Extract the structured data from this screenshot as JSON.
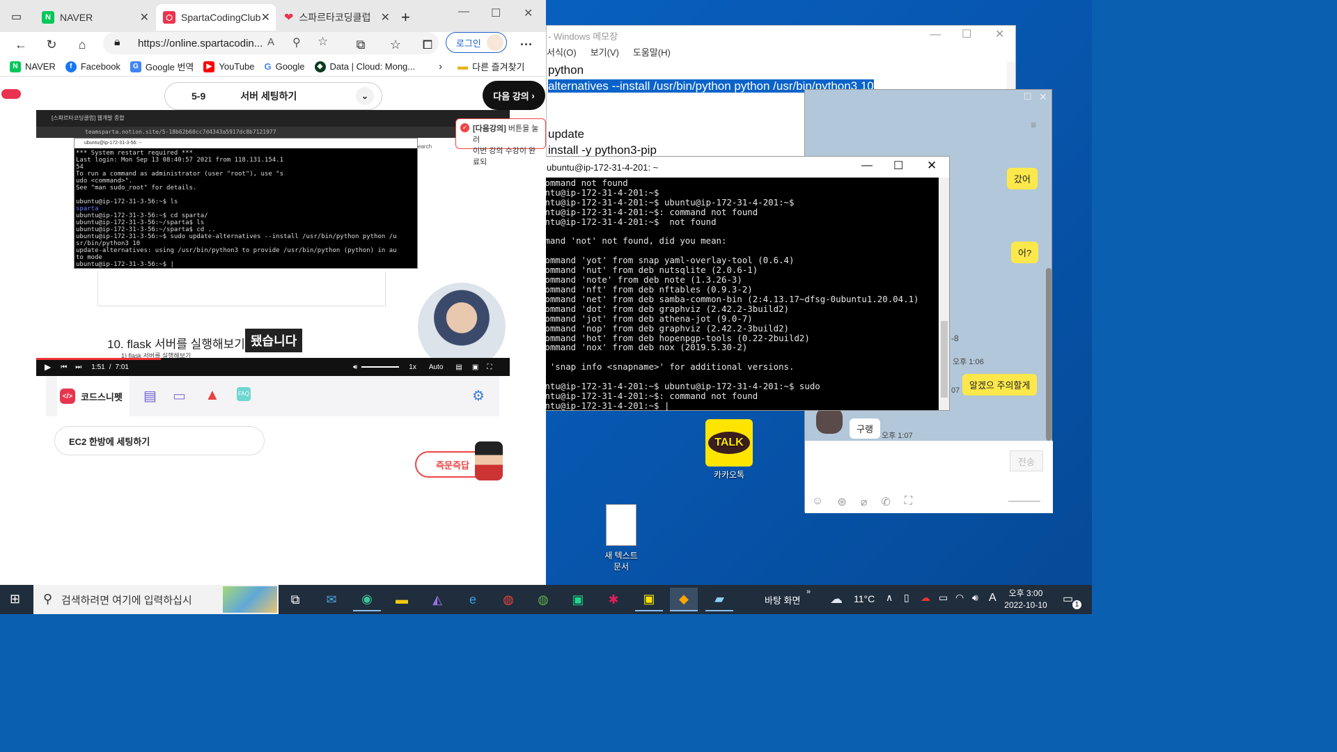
{
  "browser": {
    "tabs": [
      {
        "label": "NAVER",
        "icon": "naver-icon"
      },
      {
        "label": "SpartaCodingClub",
        "icon": "sparta-icon"
      },
      {
        "label": "스파르타코딩클럽",
        "icon": "heart-icon"
      }
    ],
    "url": "https://online.spartacodin...",
    "login_label": "로그인",
    "bookmarks": [
      "NAVER",
      "Facebook",
      "Google 번역",
      "YouTube",
      "Google",
      "Data | Cloud: Mong..."
    ],
    "other_bookmarks": "다른 즐겨찾기"
  },
  "lesson": {
    "number": "5-9",
    "title": "서버 세팅하기",
    "next_label": "다음 강의",
    "tooltip_bold": "[다음강의]",
    "tooltip_line1": " 버튼을 눌러",
    "tooltip_line2": "이번 강의 수강이 완료되"
  },
  "video": {
    "address": "teamsparta.notion.site/5-18b62b60cc7d4343a5917dc8b7121977",
    "tab_label": "[스파르타코딩클럽] 웹개발 종합",
    "inner_term_title": "ubuntu@ip-172-31-3-56: ~",
    "inner_term_lines": [
      "*** System restart required ***",
      "Last login: Mon Sep 13 08:40:57 2021 from 118.131.154.1",
      "54",
      "To run a command as administrator (user \"root\"), use \"s",
      "udo <command>\".",
      "See \"man sudo_root\" for details.",
      "",
      "ubuntu@ip-172-31-3-56:~$ ls",
      "sparta",
      "ubuntu@ip-172-31-3-56:~$ cd sparta/",
      "ubuntu@ip-172-31-3-56:~/sparta$ ls",
      "ubuntu@ip-172-31-3-56:~/sparta$ cd ..",
      "ubuntu@ip-172-31-3-56:~$ sudo update-alternatives --install /usr/bin/python python /u",
      "sr/bin/python3 10",
      "update-alternatives: using /usr/bin/python3 to provide /usr/bin/python (python) in au",
      "to mode",
      "ubuntu@ip-172-31-3-56:~$ |"
    ],
    "heading": "10. flask 서버를 실행해보기",
    "subtitle": "됐습니다",
    "subheading": "1) flask 서버를 실행해보기",
    "search_label": "earch",
    "time_current": "1:51",
    "time_total": "7:01",
    "speed": "1x",
    "quality": "Auto",
    "progress_fraction": 0.263
  },
  "snippet": {
    "tab_label": "코드스니펫",
    "faq": "FAQ",
    "card_label": "EC2 한방에 세팅하기",
    "ask_label": "즉문즉답"
  },
  "notepad": {
    "title": "- Windows 메모장",
    "menu": [
      "서식(O)",
      "보기(V)",
      "도움말(H)"
    ],
    "lines": [
      {
        "text": "python",
        "highlight": false
      },
      {
        "text": "alternatives --install /usr/bin/python python /usr/bin/python3 10",
        "highlight": true
      },
      {
        "text": "",
        "highlight": false
      },
      {
        "text": "",
        "highlight": false
      },
      {
        "text": "update",
        "highlight": false
      },
      {
        "text": "install -y python3-pip",
        "highlight": false
      }
    ]
  },
  "kakao": {
    "bubble1": "갔어",
    "bubble2": "어?",
    "time_partial": "-8",
    "time1": "오후 1:06",
    "bubble3": "알겠으 주의할게",
    "time_prefix": "07",
    "reply": "구랭",
    "time2": "오후 1:07",
    "send_label": "전송"
  },
  "putty": {
    "title": "ubuntu@ip-172-31-4-201: ~",
    "lines": [
      ": command not found",
      "ubuntu@ip-172-31-4-201:~$",
      "ubuntu@ip-172-31-4-201:~$ ubuntu@ip-172-31-4-201:~$",
      "ubuntu@ip-172-31-4-201:~$: command not found",
      "ubuntu@ip-172-31-4-201:~$  not found",
      "",
      "Command 'not' not found, did you mean:",
      "",
      "  command 'yot' from snap yaml-overlay-tool (0.6.4)",
      "  command 'nut' from deb nutsqlite (2.0.6-1)",
      "  command 'note' from deb note (1.3.26-3)",
      "  command 'nft' from deb nftables (0.9.3-2)",
      "  command 'net' from deb samba-common-bin (2:4.13.17~dfsg-0ubuntu1.20.04.1)",
      "  command 'dot' from deb graphviz (2.42.2-3build2)",
      "  command 'jot' from deb athena-jot (9.0-7)",
      "  command 'nop' from deb graphviz (2.42.2-3build2)",
      "  command 'hot' from deb hopenpgp-tools (0.22-2build2)",
      "  command 'nox' from deb nox (2019.5.30-2)",
      "",
      "See 'snap info <snapname>' for additional versions.",
      "",
      "ubuntu@ip-172-31-4-201:~$ ubuntu@ip-172-31-4-201:~$ sudo",
      "ubuntu@ip-172-31-4-201:~$: command not found",
      "ubuntu@ip-172-31-4-201:~$ |"
    ]
  },
  "desktop": {
    "icon_kakao": "카카오톡",
    "icon_kakao_logo": "TALK",
    "icon_textfile": "새 텍스트\n문서"
  },
  "taskbar": {
    "search_placeholder": "검색하려면 여기에 입력하십시",
    "desktop_label": "바탕 화면",
    "temperature": "11°C",
    "ime": "A",
    "time": "오후 3:00",
    "date": "2022-10-10",
    "notif_count": "1"
  }
}
